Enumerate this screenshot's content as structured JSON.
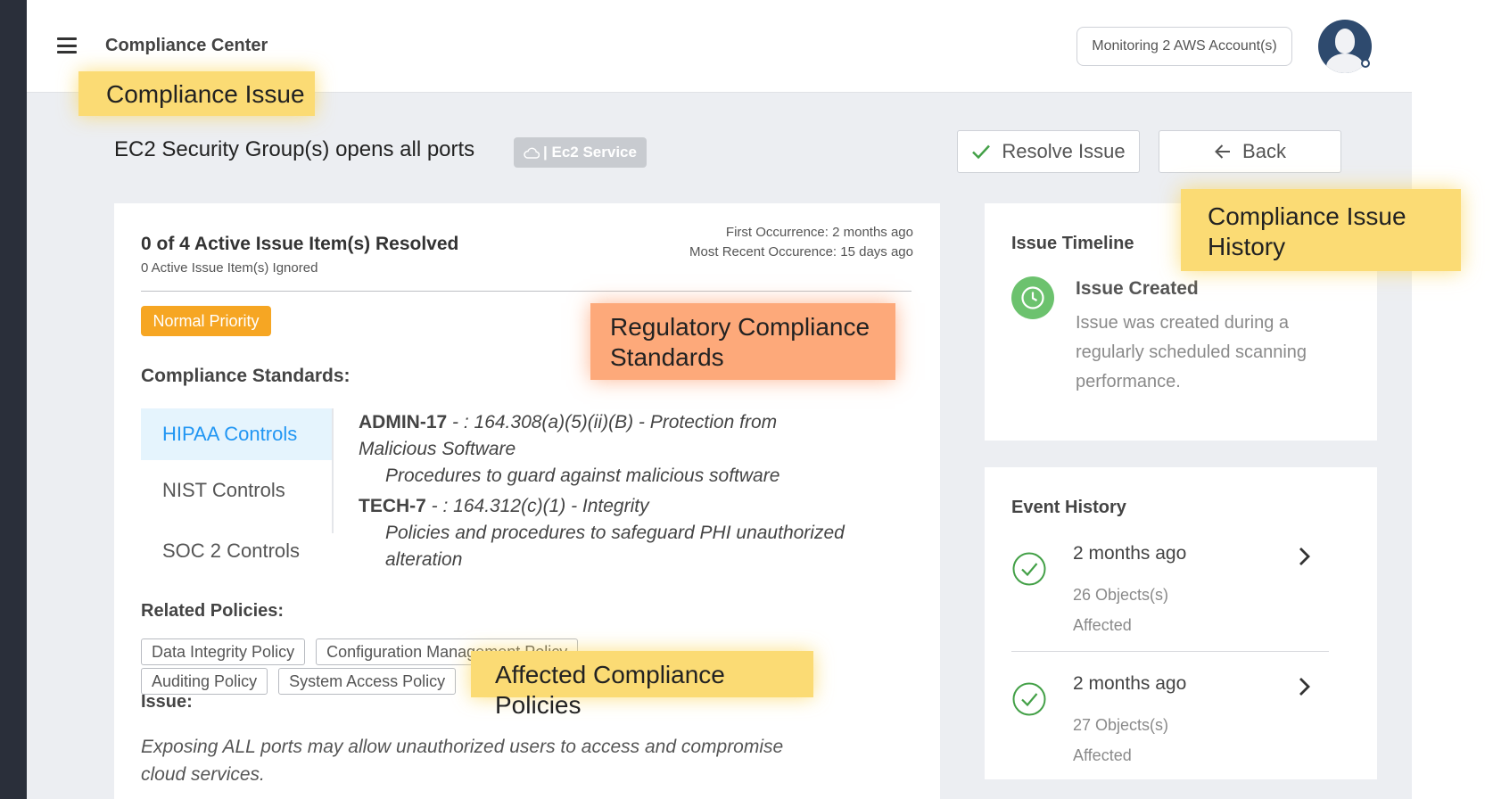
{
  "app": {
    "title": "Compliance Center",
    "aws_button_label": "Monitoring 2 AWS Account(s)",
    "menu_icon": "hamburger-menu-icon",
    "avatar_icon": "user-avatar-icon"
  },
  "callouts": {
    "compliance_issue": "Compliance Issue",
    "issue_history_line1": "Compliance Issue",
    "issue_history_line2": "History",
    "regulatory_line1": "Regulatory Compliance",
    "regulatory_line2": "Standards",
    "affected_policies": "Affected Compliance Policies"
  },
  "issue": {
    "title": "EC2 Security Group(s) opens all ports",
    "service_badge": "| Ec2 Service",
    "service_icon": "cloud-icon",
    "resolve_label": "Resolve Issue",
    "back_label": "Back"
  },
  "summary": {
    "resolved": "0 of 4 Active Issue Item(s) Resolved",
    "ignored": "0 Active Issue Item(s) Ignored",
    "first_occurrence": "First Occurrence: 2 months ago",
    "recent_occurrence": "Most Recent Occurence: 15 days ago",
    "priority": "Normal Priority"
  },
  "standards": {
    "label": "Compliance Standards:",
    "tabs": [
      {
        "label": "HIPAA Controls",
        "active": true
      },
      {
        "label": "NIST Controls",
        "active": false
      },
      {
        "label": "SOC 2 Controls",
        "active": false
      }
    ],
    "items": [
      {
        "code": "ADMIN-17",
        "reference_line1": " - : 164.308(a)(5)(ii)(B) - Protection from",
        "reference_line2": "Malicious Software",
        "description": "Procedures to guard against malicious software"
      },
      {
        "code": "TECH-7",
        "reference_line1": " - : 164.312(c)(1) - Integrity",
        "description_line1": "Policies and procedures to safeguard PHI unauthorized",
        "description_line2": "alteration"
      }
    ]
  },
  "policies": {
    "label": "Related Policies:",
    "items": [
      "Data Integrity Policy",
      "Configuration Management Policy",
      "Auditing Policy",
      "System Access Policy"
    ]
  },
  "issue_detail": {
    "label": "Issue:",
    "description": "Exposing ALL ports may allow unauthorized users to access and compromise cloud services."
  },
  "timeline": {
    "title": "Issue Timeline",
    "event_title": "Issue Created",
    "event_description": "Issue was created during a regularly scheduled scanning performance.",
    "event_icon": "clock-icon"
  },
  "event_history": {
    "title": "Event History",
    "events": [
      {
        "when": "2 months ago",
        "objects": "26 Objects(s)",
        "status": "Affected"
      },
      {
        "when": "2 months ago",
        "objects": "27 Objects(s)",
        "status": "Affected"
      }
    ]
  },
  "colors": {
    "accent_blue": "#2196f3",
    "priority_orange": "#f6a623",
    "success_green": "#6cc26e",
    "callout_yellow": "#fbdb74",
    "callout_orange": "#fda97a"
  }
}
